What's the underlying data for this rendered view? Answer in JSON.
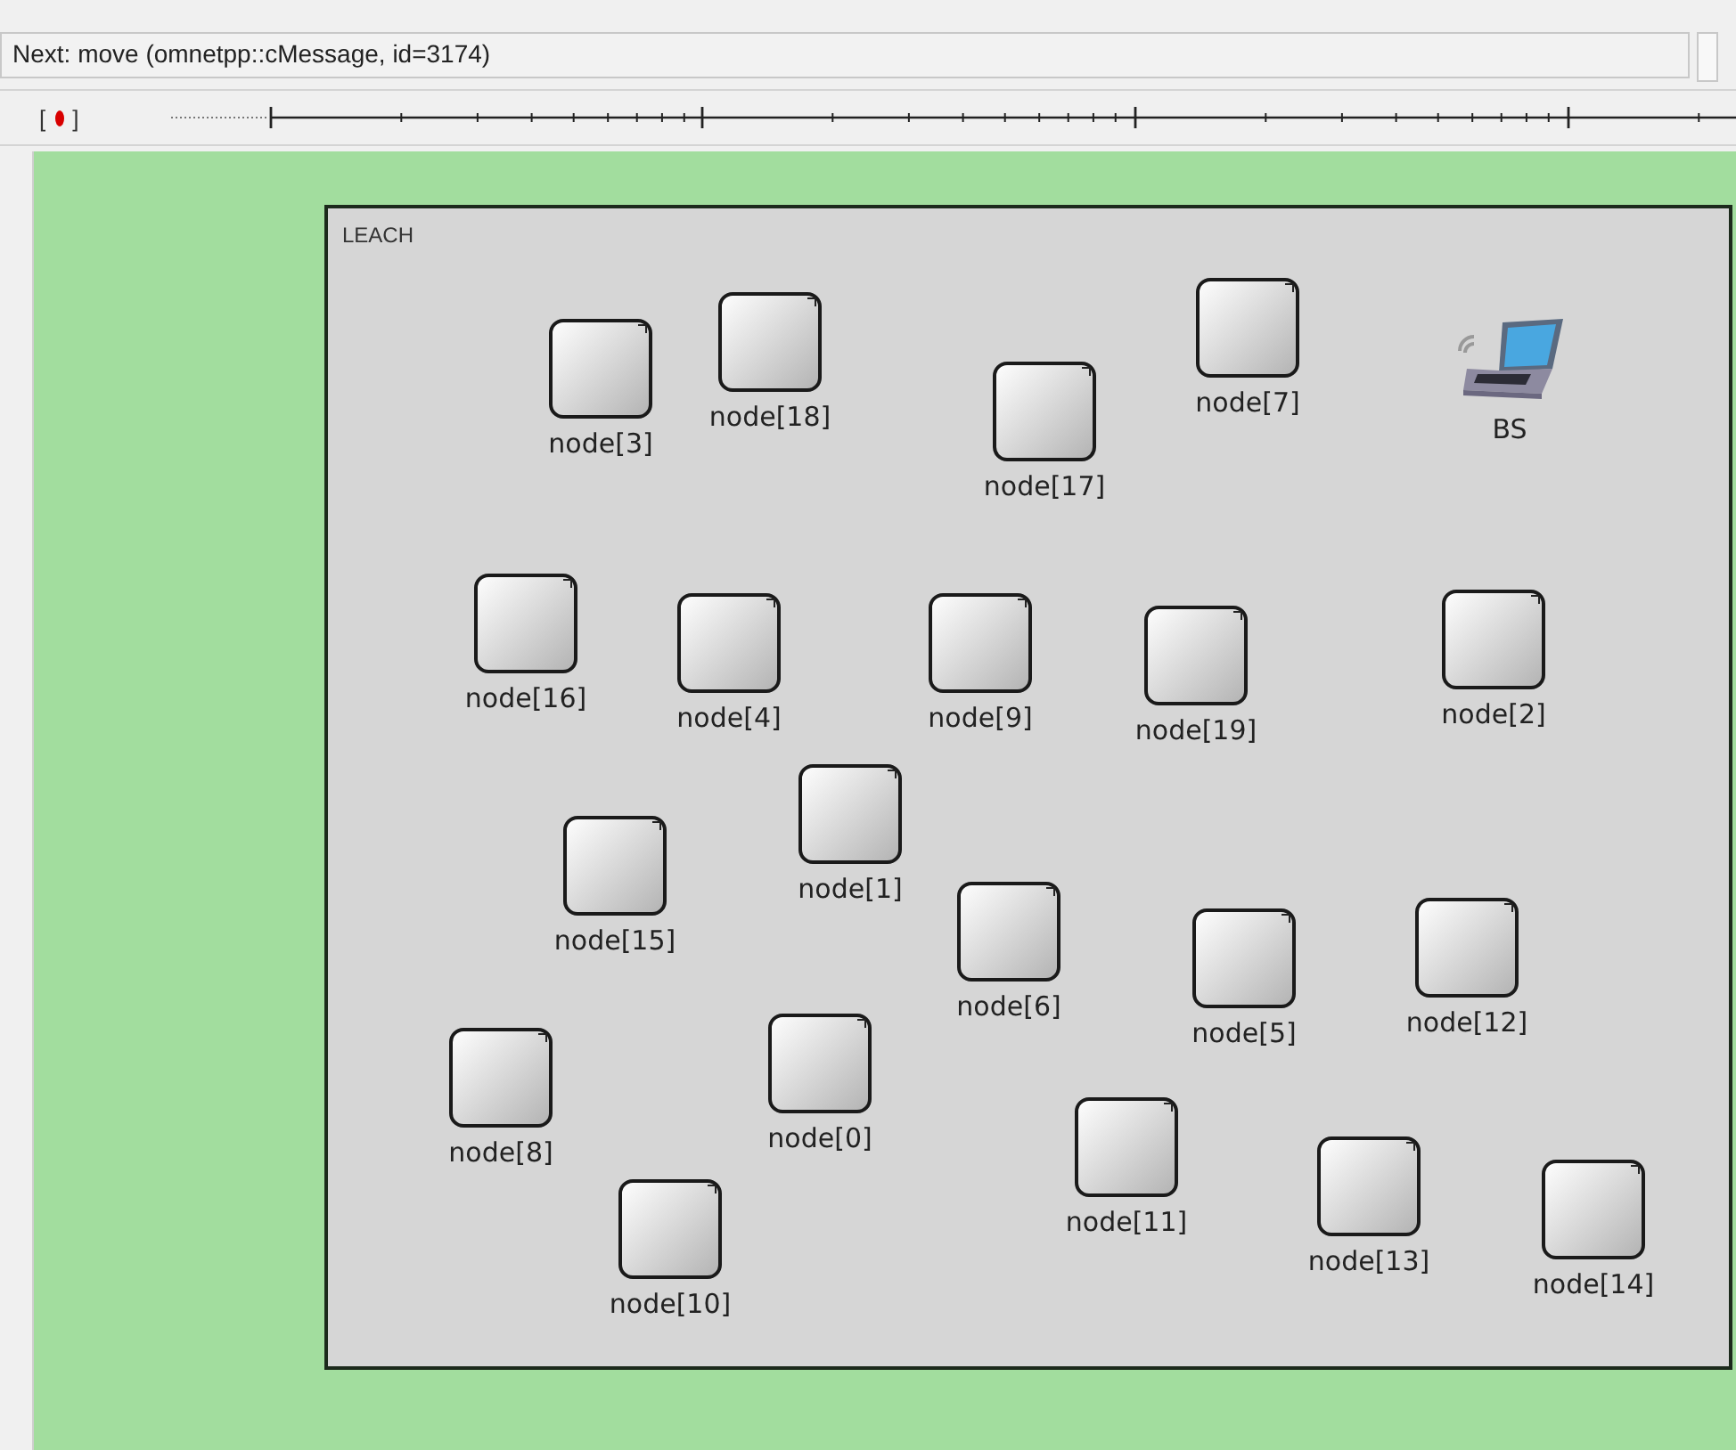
{
  "status_bar": {
    "text": "Next: move (omnetpp::cMessage, id=3174)"
  },
  "timeline": {
    "bracket_open": "[",
    "bracket_close": "]"
  },
  "network": {
    "title": "LEACH",
    "nodes": [
      {
        "label": "node[3]",
        "kind": "node"
      },
      {
        "label": "node[18]",
        "kind": "node"
      },
      {
        "label": "node[17]",
        "kind": "node"
      },
      {
        "label": "node[7]",
        "kind": "node"
      },
      {
        "label": "BS",
        "kind": "host"
      },
      {
        "label": "node[16]",
        "kind": "node"
      },
      {
        "label": "node[4]",
        "kind": "node"
      },
      {
        "label": "node[9]",
        "kind": "node"
      },
      {
        "label": "node[19]",
        "kind": "node"
      },
      {
        "label": "node[2]",
        "kind": "node"
      },
      {
        "label": "node[15]",
        "kind": "node"
      },
      {
        "label": "node[1]",
        "kind": "node"
      },
      {
        "label": "node[6]",
        "kind": "node"
      },
      {
        "label": "node[5]",
        "kind": "node"
      },
      {
        "label": "node[12]",
        "kind": "node"
      },
      {
        "label": "node[8]",
        "kind": "node"
      },
      {
        "label": "node[0]",
        "kind": "node"
      },
      {
        "label": "node[10]",
        "kind": "node"
      },
      {
        "label": "node[11]",
        "kind": "node"
      },
      {
        "label": "node[13]",
        "kind": "node"
      },
      {
        "label": "node[14]",
        "kind": "node"
      }
    ]
  }
}
